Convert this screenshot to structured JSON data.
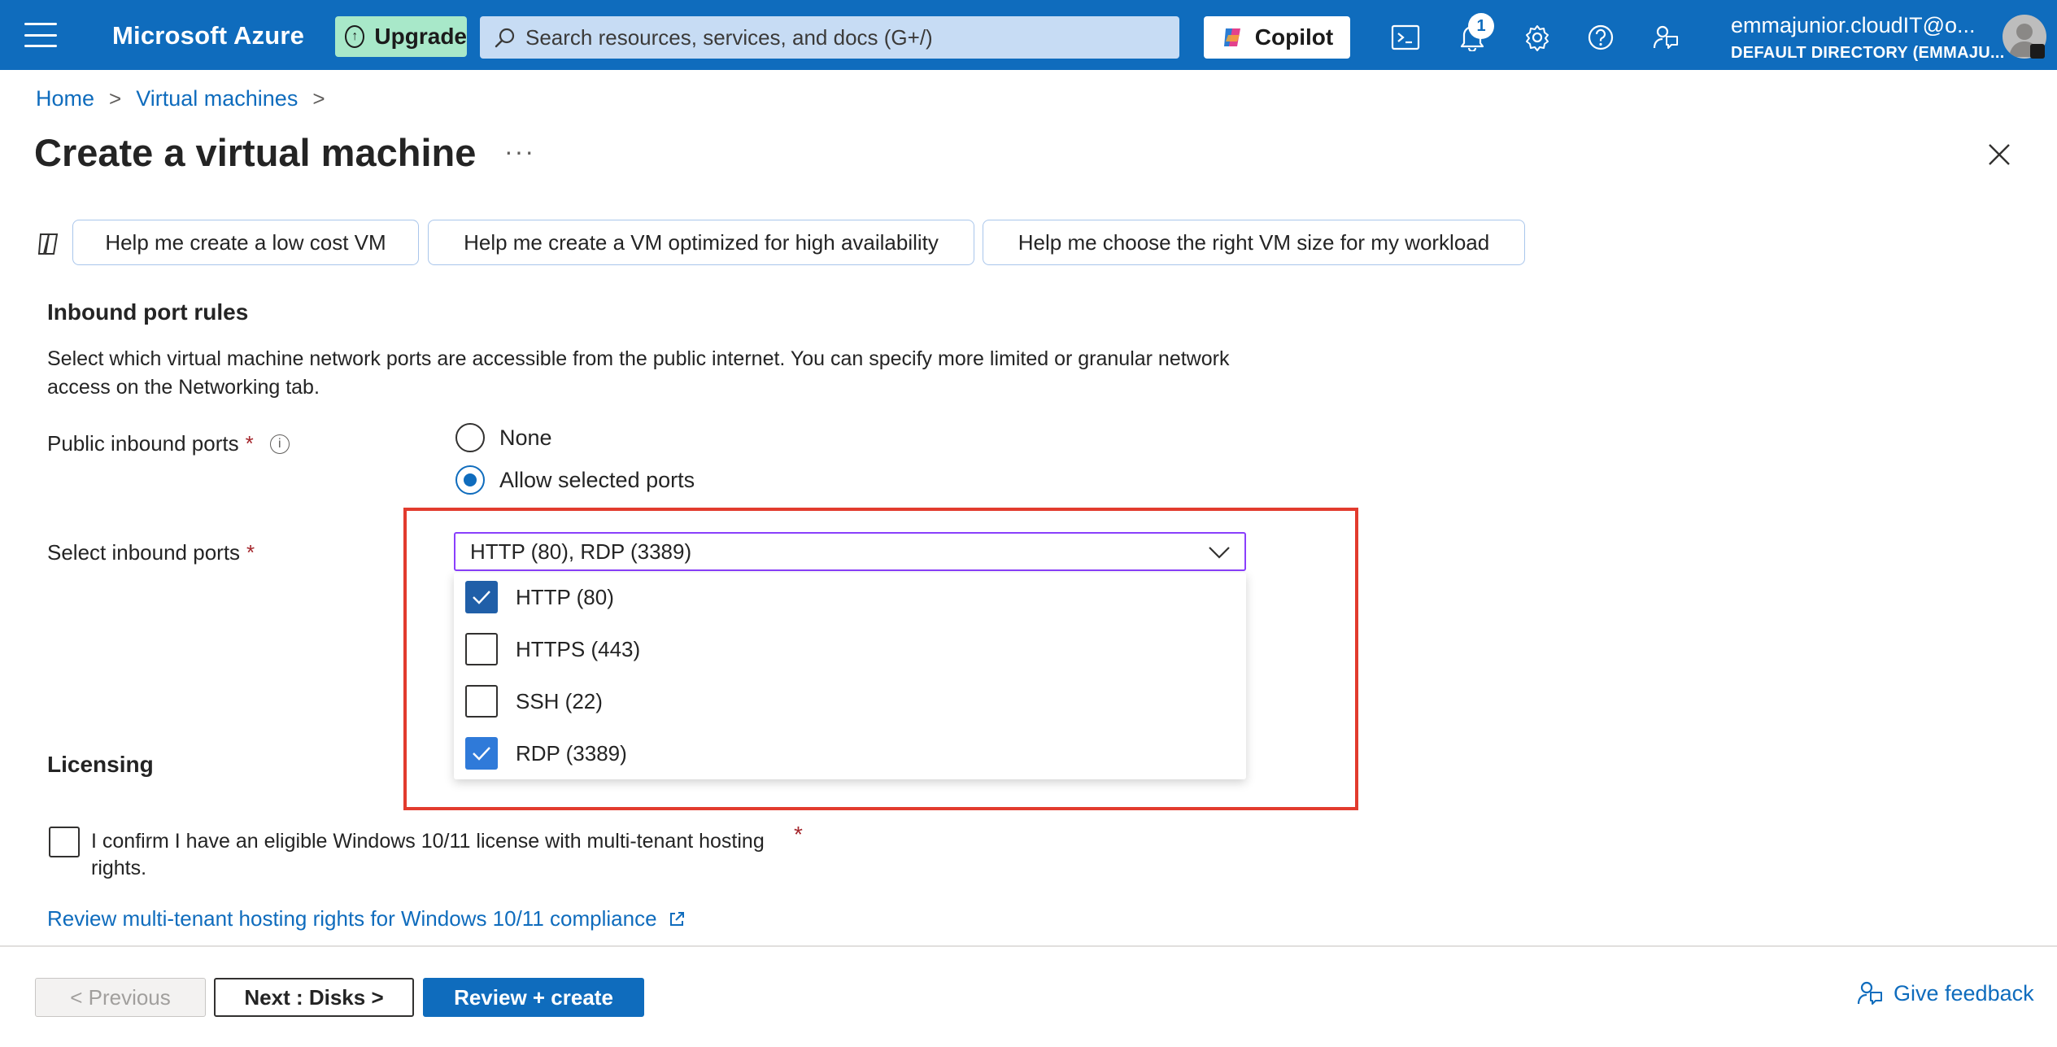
{
  "topbar": {
    "brand": "Microsoft Azure",
    "upgrade_label": "Upgrade",
    "search_placeholder": "Search resources, services, and docs (G+/)",
    "copilot_label": "Copilot",
    "notification_count": "1",
    "account_email": "emmajunior.cloudIT@o...",
    "account_directory": "DEFAULT DIRECTORY (EMMAJU...",
    "icons": [
      "menu-icon",
      "cloud-shell-icon",
      "bell-icon",
      "gear-icon",
      "help-icon",
      "feedback-icon"
    ],
    "accent_color": "#0f6cbd"
  },
  "breadcrumb": {
    "items": [
      "Home",
      "Virtual machines"
    ]
  },
  "page": {
    "title": "Create a virtual machine",
    "more_label": "···"
  },
  "suggestions": [
    "Help me create a low cost VM",
    "Help me create a VM optimized for high availability",
    "Help me choose the right VM size for my workload"
  ],
  "inbound": {
    "heading": "Inbound port rules",
    "description": "Select which virtual machine network ports are accessible from the public internet. You can specify more limited or granular network access on the Networking tab.",
    "public_ports_label": "Public inbound ports",
    "required_mark": "*",
    "radio_options": [
      {
        "label": "None",
        "selected": false
      },
      {
        "label": "Allow selected ports",
        "selected": true
      }
    ],
    "select_label": "Select inbound ports",
    "select_value": "HTTP (80), RDP (3389)",
    "port_options": [
      {
        "label": "HTTP (80)",
        "checked": true
      },
      {
        "label": "HTTPS (443)",
        "checked": false
      },
      {
        "label": "SSH (22)",
        "checked": false
      },
      {
        "label": "RDP (3389)",
        "checked": true
      }
    ]
  },
  "licensing": {
    "heading": "Licensing",
    "confirm_text": "I confirm I have an eligible Windows 10/11 license with multi-tenant hosting rights.",
    "required_mark": "*",
    "review_link": "Review multi-tenant hosting rights for Windows 10/11 compliance"
  },
  "footer": {
    "previous_label": "< Previous",
    "next_label": "Next : Disks >",
    "review_label": "Review + create",
    "feedback_label": "Give feedback"
  },
  "colors": {
    "highlight_border": "#e23b2e",
    "link": "#0f6cbd",
    "required": "#a4262c"
  }
}
